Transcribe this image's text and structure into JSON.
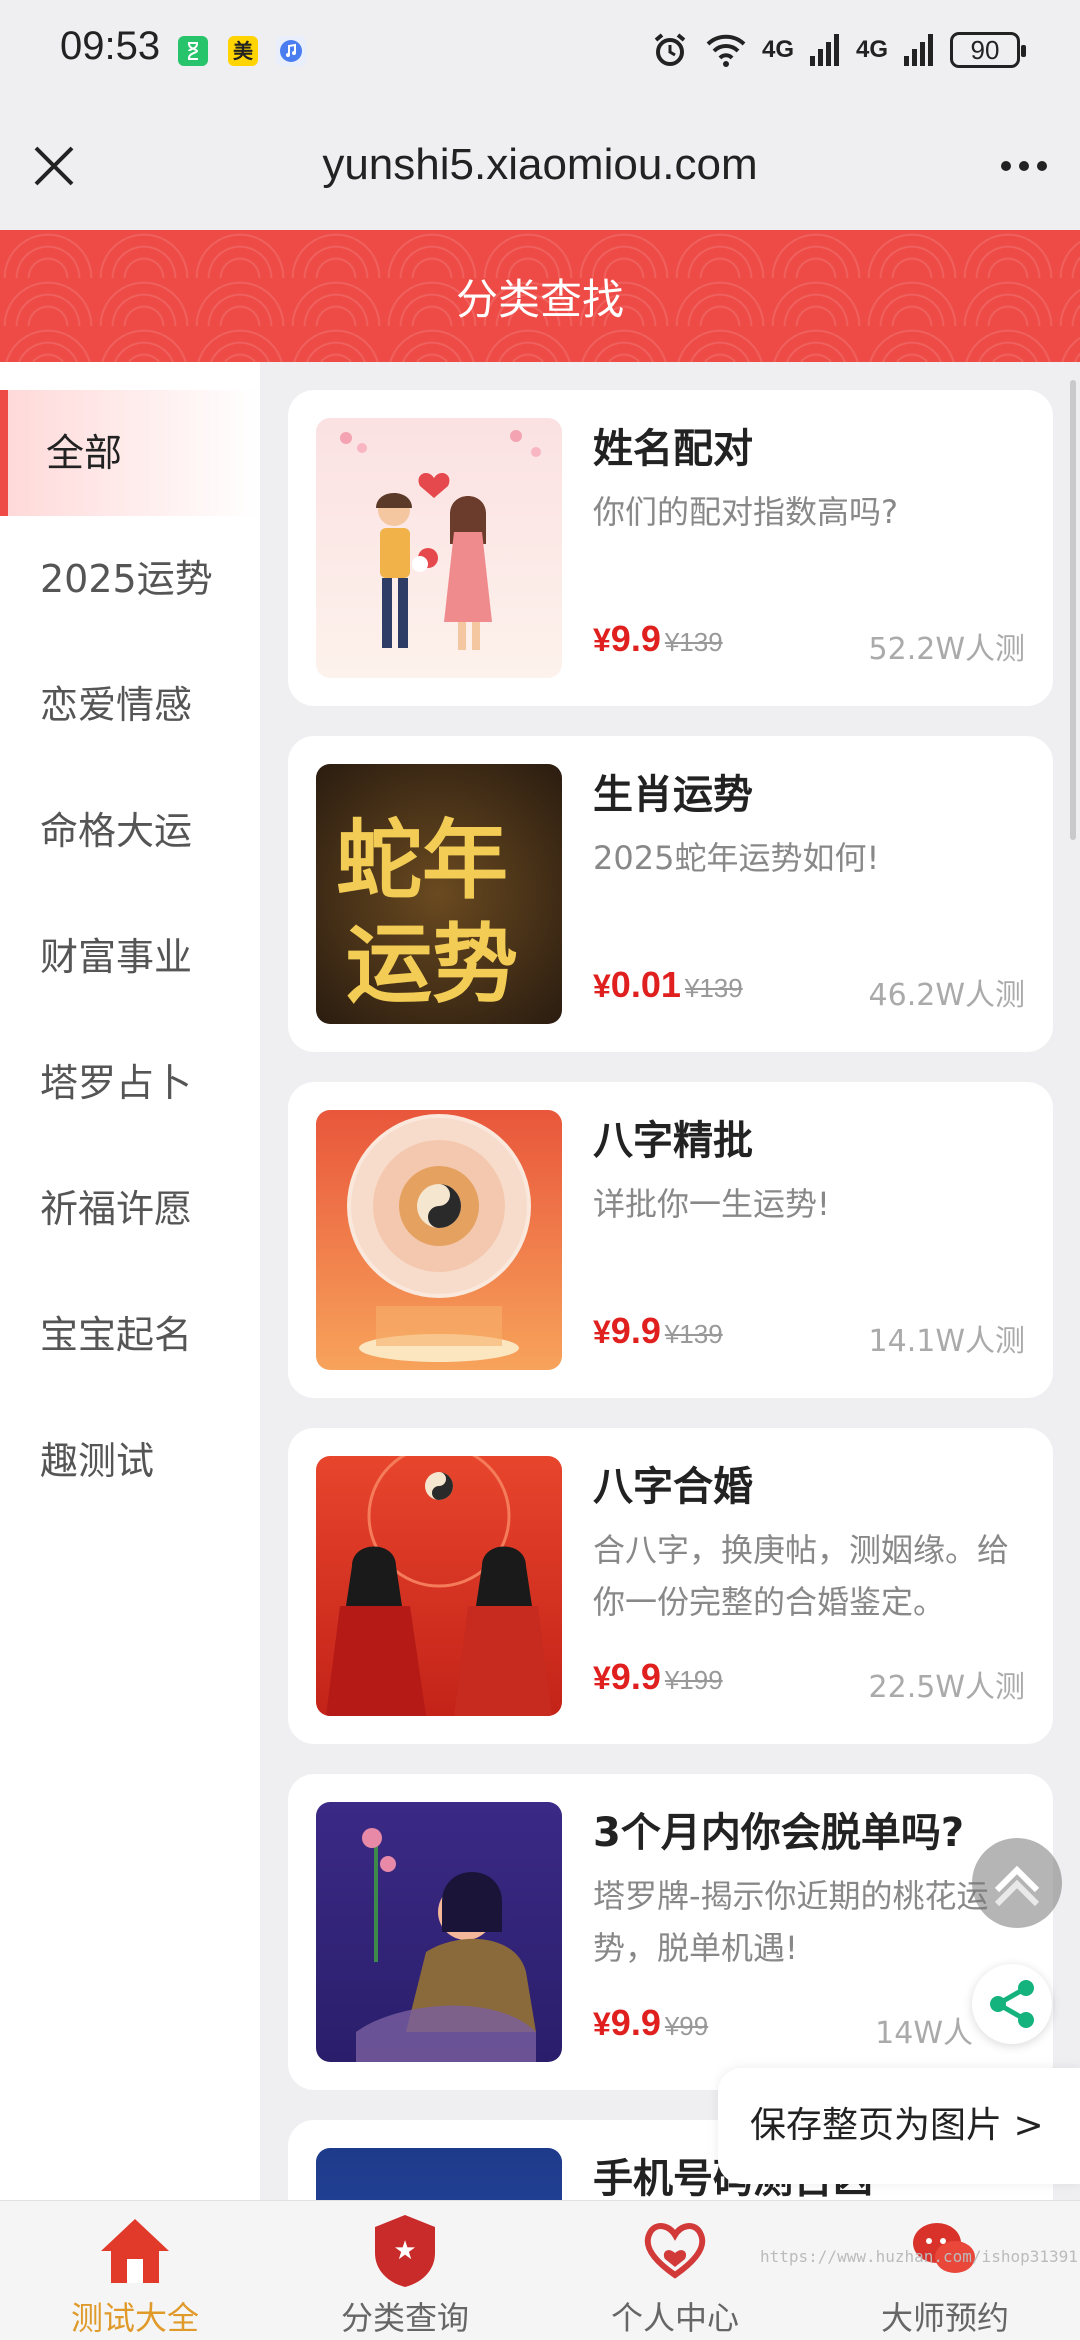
{
  "status_bar": {
    "time": "09:53",
    "app_icon_2_glyph": "美",
    "signal_label_1": "4G",
    "signal_label_2": "4G",
    "battery": "90",
    "icons": [
      "hourglass-app-icon",
      "meituan-app-icon",
      "music-app-icon",
      "alarm-icon",
      "wifi-icon",
      "signal-icon",
      "signal-icon",
      "battery-icon"
    ]
  },
  "browser": {
    "url": "yunshi5.xiaomiou.com"
  },
  "header": {
    "title": "分类查找",
    "accent_color": "#ee4b47"
  },
  "sidebar": {
    "items": [
      {
        "label": "全部",
        "active": true
      },
      {
        "label": "2025运势"
      },
      {
        "label": "恋爱情感"
      },
      {
        "label": "命格大运"
      },
      {
        "label": "财富事业"
      },
      {
        "label": "塔罗占卜"
      },
      {
        "label": "祈福许愿"
      },
      {
        "label": "宝宝起名"
      },
      {
        "label": "趣测试"
      }
    ]
  },
  "cards": [
    {
      "title": "姓名配对",
      "subtitle": "你们的配对指数高吗?",
      "currency": "¥",
      "price": "9.9",
      "orig": "¥139",
      "count": "52.2W人测"
    },
    {
      "title": "生肖运势",
      "subtitle": "2025蛇年运势如何!",
      "currency": "¥",
      "price": "0.01",
      "orig": "¥139",
      "count": "46.2W人测",
      "thumb_text_1": "蛇年",
      "thumb_text_2": "运势"
    },
    {
      "title": "八字精批",
      "subtitle": "详批你一生运势!",
      "currency": "¥",
      "price": "9.9",
      "orig": "¥139",
      "count": "14.1W人测"
    },
    {
      "title": "八字合婚",
      "subtitle": "合八字，换庚帖，测姻缘。给你一份完整的合婚鉴定。",
      "currency": "¥",
      "price": "9.9",
      "orig": "¥199",
      "count": "22.5W人测"
    },
    {
      "title": "3个月内你会脱单吗?",
      "subtitle": "塔罗牌-揭示你近期的桃花运势，脱单机遇!",
      "currency": "¥",
      "price": "9.9",
      "orig": "¥99",
      "count": "14W人"
    },
    {
      "title": "手机号码测吉凶"
    }
  ],
  "floating": {
    "save_page": "保存整页为图片 >"
  },
  "bottom_nav": {
    "items": [
      {
        "label": "测试大全",
        "icon": "home-icon",
        "active": true
      },
      {
        "label": "分类查询",
        "icon": "category-badge-icon"
      },
      {
        "label": "个人中心",
        "icon": "heart-hands-icon"
      },
      {
        "label": "大师预约",
        "icon": "chat-bubble-icon"
      }
    ],
    "watermark": "https://www.huzhan.com/ishop31391"
  }
}
